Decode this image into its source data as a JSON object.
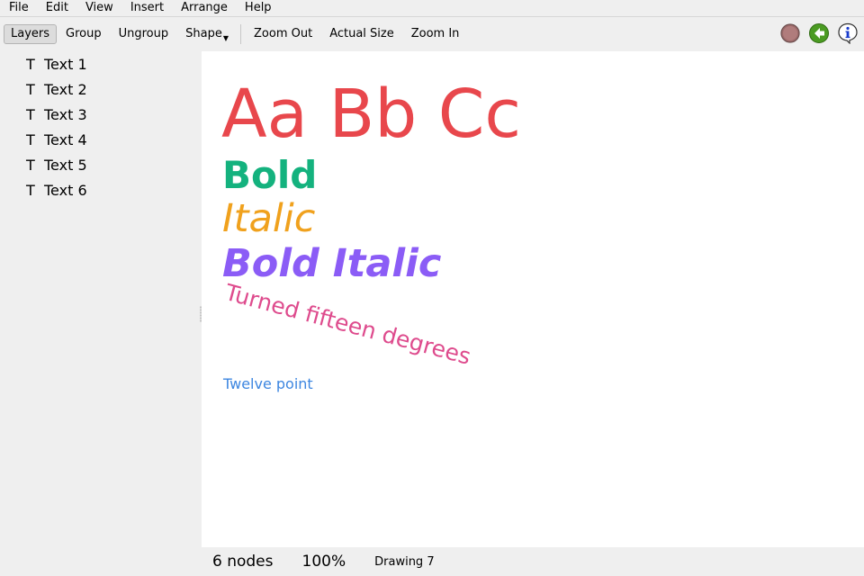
{
  "menubar": {
    "items": [
      "File",
      "Edit",
      "View",
      "Insert",
      "Arrange",
      "Help"
    ]
  },
  "toolbar": {
    "layers": "Layers",
    "group": "Group",
    "ungroup": "Ungroup",
    "shape": "Shape",
    "zoom_out": "Zoom Out",
    "actual_size": "Actual Size",
    "zoom_in": "Zoom In",
    "icons": [
      "record-icon",
      "back-arrow-icon",
      "info-icon"
    ]
  },
  "layers": {
    "icon": "T",
    "items": [
      "Text 1",
      "Text 2",
      "Text 3",
      "Text 4",
      "Text 5",
      "Text 6"
    ]
  },
  "canvas": {
    "text1": "Aa Bb Cc",
    "text2": "Bold",
    "text3": "Italic",
    "text4": "Bold Italic",
    "text5": "Turned fifteen degrees",
    "text6": "Twelve point"
  },
  "colors": {
    "text1": "#e8474c",
    "text2": "#14b27e",
    "text3": "#f0a11d",
    "text4": "#8b5cf6",
    "text5": "#de4b8d",
    "text6": "#3d86e0"
  },
  "status": {
    "nodes": "6 nodes",
    "zoom": "100%",
    "document": "Drawing 7"
  }
}
